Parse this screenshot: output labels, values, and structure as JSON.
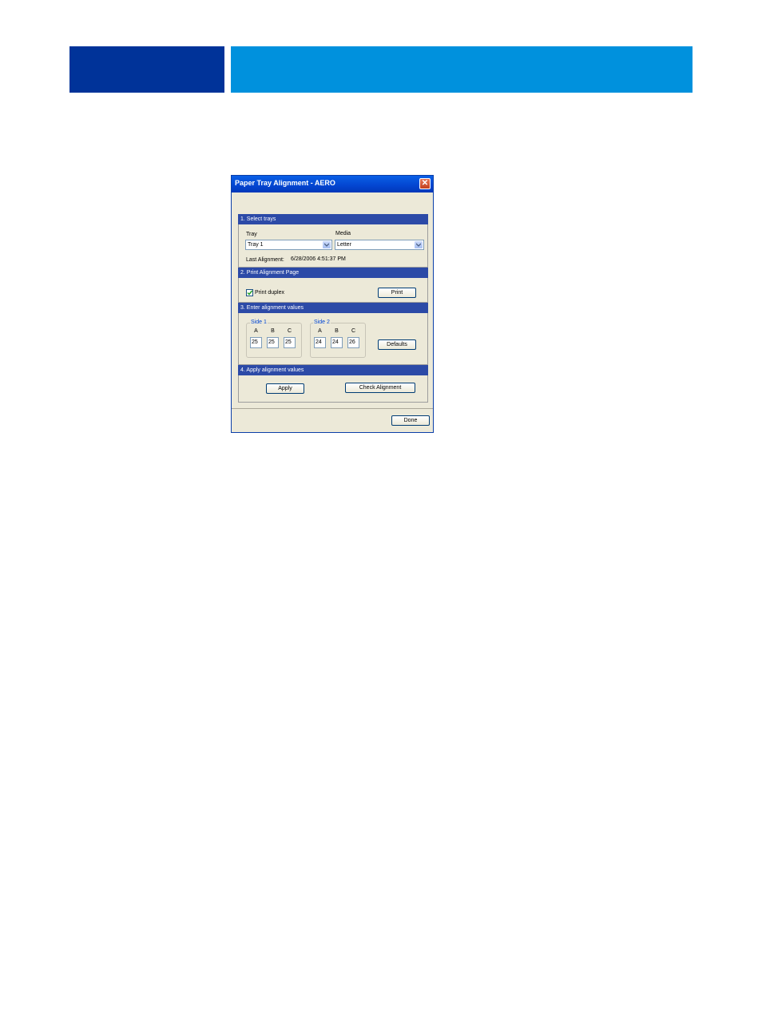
{
  "colors": {
    "band_dark": "#003399",
    "band_light": "#0091dd"
  },
  "dialog": {
    "title": "Paper Tray Alignment - AERO",
    "close_glyph": "✕",
    "section1": {
      "header": "1. Select trays",
      "tray_label": "Tray",
      "tray_value": "Tray 1",
      "media_label": "Media",
      "media_value": "Letter",
      "last_alignment_label": "Last Alignment:",
      "last_alignment_value": "6/28/2006 4:51:37 PM"
    },
    "section2": {
      "header": "2. Print Alignment Page",
      "duplex_label": "Print duplex",
      "duplex_checked": true,
      "print_button": "Print"
    },
    "section3": {
      "header": "3. Enter alignment values",
      "side1": {
        "title": "Side 1",
        "cols": [
          "A",
          "B",
          "C"
        ],
        "values": [
          "25",
          "25",
          "25"
        ]
      },
      "side2": {
        "title": "Side 2",
        "cols": [
          "A",
          "B",
          "C"
        ],
        "values": [
          "24",
          "24",
          "26"
        ]
      },
      "defaults_button": "Defaults"
    },
    "section4": {
      "header": "4. Apply alignment values",
      "apply_button": "Apply",
      "check_button": "Check Alignment"
    },
    "done_button": "Done"
  }
}
